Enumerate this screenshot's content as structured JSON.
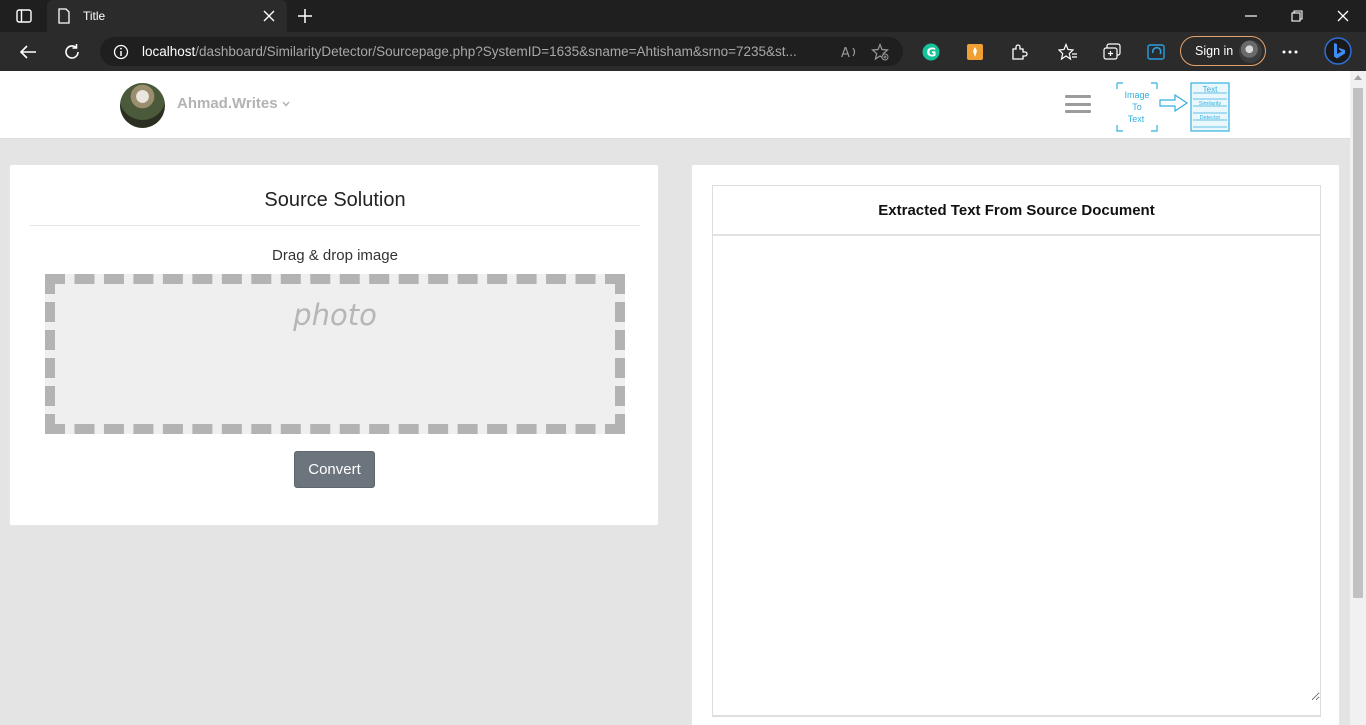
{
  "browser": {
    "tab_title": "Title",
    "url_host": "localhost",
    "url_path": "/dashboard/SimilarityDetector/Sourcepage.php?SystemID=1635&sname=Ahtisham&srno=7235&st...",
    "signin_label": "Sign in"
  },
  "header": {
    "username": "Ahmad.Writes",
    "logo_text": {
      "left_line1": "Image",
      "left_line2": "To",
      "left_line3": "Text",
      "right_line1": "Text",
      "right_line2": "Similarity",
      "right_line3": "Detector"
    }
  },
  "left_card": {
    "title": "Source Solution",
    "dropzone_label": "Drag & drop image",
    "placeholder": "photo",
    "convert_label": "Convert"
  },
  "right_card": {
    "title": "Extracted Text From Source Document",
    "textarea_value": ""
  },
  "colors": {
    "accent_logo": "#34b0e0",
    "button_gray": "#6c757d",
    "signin_border": "#e8a36b"
  }
}
